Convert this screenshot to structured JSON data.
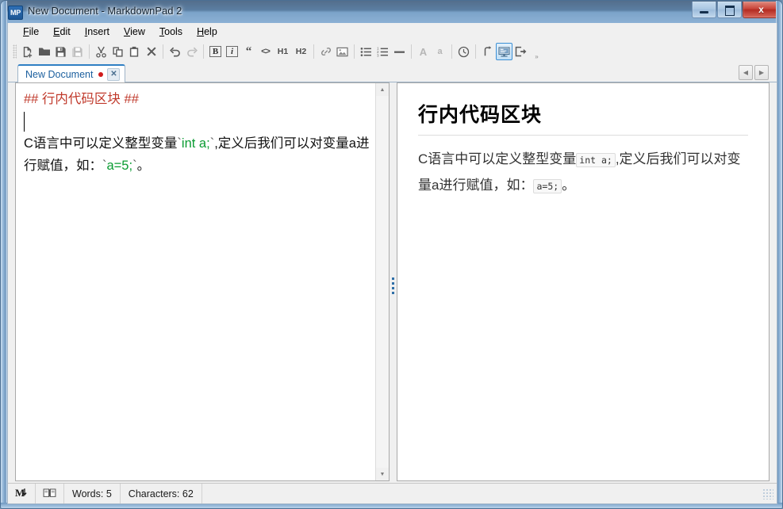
{
  "window": {
    "title": "New Document - MarkdownPad 2",
    "logo_text": "MP",
    "minimize_label": "Minimize",
    "maximize_label": "Maximize",
    "close_label": "x"
  },
  "menubar": {
    "items": [
      {
        "pre": "",
        "key": "F",
        "post": "ile"
      },
      {
        "pre": "",
        "key": "E",
        "post": "dit"
      },
      {
        "pre": "",
        "key": "I",
        "post": "nsert"
      },
      {
        "pre": "",
        "key": "V",
        "post": "iew"
      },
      {
        "pre": "",
        "key": "T",
        "post": "ools"
      },
      {
        "pre": "",
        "key": "H",
        "post": "elp"
      }
    ]
  },
  "toolbar": {
    "buttons": [
      {
        "name": "new-document-icon",
        "tip": "New"
      },
      {
        "name": "open-folder-icon",
        "tip": "Open"
      },
      {
        "name": "save-icon",
        "tip": "Save"
      },
      {
        "name": "save-as-icon",
        "tip": "Save As"
      },
      {
        "name": "cut-icon",
        "tip": "Cut"
      },
      {
        "name": "copy-icon",
        "tip": "Copy"
      },
      {
        "name": "paste-icon",
        "tip": "Paste"
      },
      {
        "name": "delete-icon",
        "tip": "Delete"
      },
      {
        "name": "undo-icon",
        "tip": "Undo"
      },
      {
        "name": "redo-icon",
        "tip": "Redo"
      },
      {
        "name": "bold-icon",
        "tip": "Bold",
        "glyph": "B"
      },
      {
        "name": "italic-icon",
        "tip": "Italic",
        "glyph": "i"
      },
      {
        "name": "blockquote-icon",
        "tip": "Blockquote",
        "glyph": "“"
      },
      {
        "name": "inline-code-icon",
        "tip": "Code",
        "glyph": "<>"
      },
      {
        "name": "heading1-icon",
        "tip": "Heading 1",
        "glyph": "H1"
      },
      {
        "name": "heading2-icon",
        "tip": "Heading 2",
        "glyph": "H2"
      },
      {
        "name": "link-icon",
        "tip": "Link"
      },
      {
        "name": "image-icon",
        "tip": "Image"
      },
      {
        "name": "bullet-list-icon",
        "tip": "Bulleted List"
      },
      {
        "name": "numbered-list-icon",
        "tip": "Numbered List"
      },
      {
        "name": "horizontal-rule-icon",
        "tip": "Horizontal Rule"
      },
      {
        "name": "uppercase-font-icon",
        "tip": "Font Larger",
        "glyph": "A"
      },
      {
        "name": "lowercase-font-icon",
        "tip": "Font Smaller",
        "glyph": "a"
      },
      {
        "name": "timestamp-icon",
        "tip": "Insert Time"
      },
      {
        "name": "line-break-icon",
        "tip": "Line Break"
      },
      {
        "name": "live-preview-icon",
        "tip": "Live Preview"
      },
      {
        "name": "export-icon",
        "tip": "Export"
      }
    ],
    "overflow_label": "»"
  },
  "tabs": {
    "items": [
      {
        "label": "New Document",
        "dirty": true,
        "close_label": "✕"
      }
    ],
    "nav_prev": "◀",
    "nav_next": "▶"
  },
  "editor": {
    "line1_heading": "## 行内代码区块 ##",
    "line2": "",
    "line3_a": "C语言中可以定义整型变量",
    "tick": "`",
    "code1": "int a;",
    "line3_b": ",定义后我们可以对变量a进行赋值，如：",
    "code2": "a=5;",
    "line3_c": "。"
  },
  "preview": {
    "heading": "行内代码区块",
    "para_a": "C语言中可以定义整型变量",
    "code1": "int a;",
    "para_b": ",定义后我们可以对变量a进行赋值，如：",
    "code2": "a=5;",
    "para_c": "。"
  },
  "statusbar": {
    "markdown_icon": "M",
    "book_icon": "📖",
    "words": "Words: 5",
    "characters": "Characters: 62"
  },
  "colors": {
    "accent": "#2f7fc4",
    "heading_syntax": "#c0392b",
    "inline_code": "#0a9c32",
    "tab_text": "#1b5f9e",
    "dirty_dot": "#d01c1c"
  }
}
